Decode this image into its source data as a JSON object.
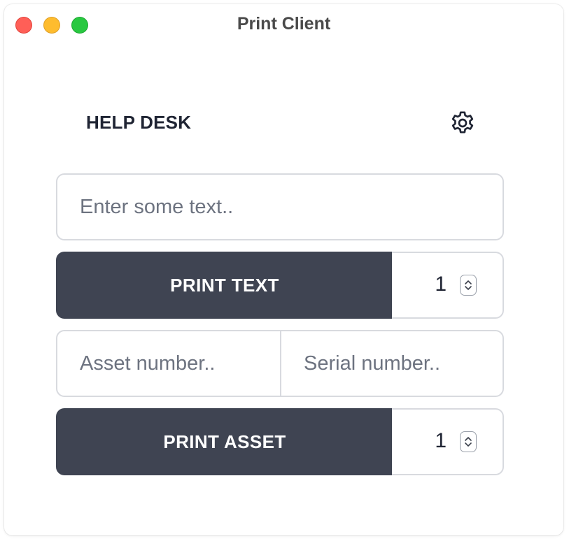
{
  "window": {
    "title": "Print Client"
  },
  "header": {
    "label": "HELP DESK",
    "settings_icon": "gear-icon"
  },
  "text_section": {
    "input_value": "",
    "input_placeholder": "Enter some text..",
    "print_button_label": "PRINT TEXT",
    "quantity": "1"
  },
  "asset_section": {
    "asset_value": "",
    "asset_placeholder": "Asset number..",
    "serial_value": "",
    "serial_placeholder": "Serial number..",
    "print_button_label": "PRINT ASSET",
    "quantity": "1"
  },
  "colors": {
    "button_bg": "#3f4452",
    "button_text": "#ffffff",
    "border": "#d8dadf",
    "placeholder": "#6d7380",
    "close": "#ff5f57",
    "minimize": "#febc2e",
    "maximize": "#28c840"
  }
}
